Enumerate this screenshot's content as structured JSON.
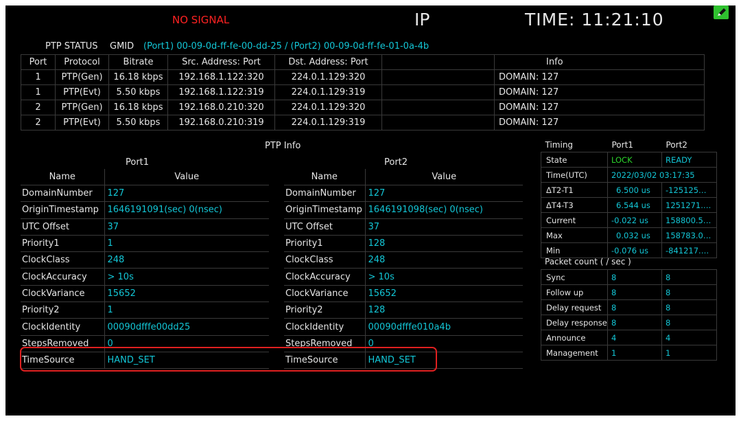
{
  "header": {
    "signal_status": "NO SIGNAL",
    "mode": "IP",
    "time": "TIME: 11:21:10"
  },
  "ptp_status": {
    "title": "PTP STATUS",
    "gmid_label": "GMID",
    "gmid_value": "(Port1) 00-09-0d-ff-fe-00-dd-25 / (Port2) 00-09-0d-ff-fe-01-0a-4b",
    "columns": [
      "Port",
      "Protocol",
      "Bitrate",
      "Src. Address: Port",
      "Dst. Address: Port",
      "Info"
    ],
    "rows": [
      {
        "port": "1",
        "protocol": "PTP(Gen)",
        "bitrate": "16.18 kbps",
        "src": "192.168.1.122:320",
        "dst": "224.0.1.129:320",
        "info": "DOMAIN: 127"
      },
      {
        "port": "1",
        "protocol": "PTP(Evt)",
        "bitrate": "5.50 kbps",
        "src": "192.168.1.122:319",
        "dst": "224.0.1.129:319",
        "info": "DOMAIN: 127"
      },
      {
        "port": "2",
        "protocol": "PTP(Gen)",
        "bitrate": "16.18 kbps",
        "src": "192.168.0.210:320",
        "dst": "224.0.1.129:320",
        "info": "DOMAIN: 127"
      },
      {
        "port": "2",
        "protocol": "PTP(Evt)",
        "bitrate": "5.50 kbps",
        "src": "192.168.0.210:319",
        "dst": "224.0.1.129:319",
        "info": "DOMAIN: 127"
      }
    ]
  },
  "ptp_info": {
    "title": "PTP Info",
    "name_header": "Name",
    "value_header": "Value",
    "port1": {
      "label": "Port1",
      "rows": [
        {
          "name": "DomainNumber",
          "value": "127"
        },
        {
          "name": "OriginTimestamp",
          "value": "1646191091(sec) 0(nsec)"
        },
        {
          "name": "UTC Offset",
          "value": "37"
        },
        {
          "name": "Priority1",
          "value": "1"
        },
        {
          "name": "ClockClass",
          "value": "248"
        },
        {
          "name": "ClockAccuracy",
          "value": "> 10s"
        },
        {
          "name": "ClockVariance",
          "value": "15652"
        },
        {
          "name": "Priority2",
          "value": "1"
        },
        {
          "name": "ClockIdentity",
          "value": "00090dfffe00dd25"
        },
        {
          "name": "StepsRemoved",
          "value": "0"
        },
        {
          "name": "TimeSource",
          "value": "HAND_SET"
        }
      ]
    },
    "port2": {
      "label": "Port2",
      "rows": [
        {
          "name": "DomainNumber",
          "value": "127"
        },
        {
          "name": "OriginTimestamp",
          "value": "1646191098(sec) 0(nsec)"
        },
        {
          "name": "UTC Offset",
          "value": "37"
        },
        {
          "name": "Priority1",
          "value": "128"
        },
        {
          "name": "ClockClass",
          "value": "248"
        },
        {
          "name": "ClockAccuracy",
          "value": "> 10s"
        },
        {
          "name": "ClockVariance",
          "value": "15652"
        },
        {
          "name": "Priority2",
          "value": "128"
        },
        {
          "name": "ClockIdentity",
          "value": "00090dfffe010a4b"
        },
        {
          "name": "StepsRemoved",
          "value": "0"
        },
        {
          "name": "TimeSource",
          "value": "HAND_SET"
        }
      ]
    }
  },
  "timing": {
    "title": "Timing",
    "port1_label": "Port1",
    "port2_label": "Port2",
    "rows": [
      {
        "name": "State",
        "port1": "LOCK",
        "port2": "READY"
      },
      {
        "name": "Time(UTC)",
        "combined": "2022/03/02 03:17:35"
      },
      {
        "name": "ΔT2-T1",
        "port1": "6.500 us",
        "port2": "-125125…"
      },
      {
        "name": "ΔT4-T3",
        "port1": "6.544 us",
        "port2": "1251271.…"
      },
      {
        "name": "Current",
        "port1": "-0.022 us",
        "port2": "158800.5…"
      },
      {
        "name": "Max",
        "port1": "0.032 us",
        "port2": "158783.0…"
      },
      {
        "name": "Min",
        "port1": "-0.076 us",
        "port2": "-841217.…"
      }
    ]
  },
  "packet_count": {
    "title": "Packet count ( / sec )",
    "rows": [
      {
        "name": "Sync",
        "port1": "8",
        "port2": "8"
      },
      {
        "name": "Follow up",
        "port1": "8",
        "port2": "8"
      },
      {
        "name": "Delay request",
        "port1": "8",
        "port2": "8"
      },
      {
        "name": "Delay response",
        "port1": "8",
        "port2": "8"
      },
      {
        "name": "Announce",
        "port1": "4",
        "port2": "4"
      },
      {
        "name": "Management",
        "port1": "1",
        "port2": "1"
      }
    ]
  },
  "colors": {
    "background": "#000000",
    "text": "#e6e6e6",
    "value": "#13c6d6",
    "lock": "#2cd42c",
    "alert": "#ff2222",
    "highlight_box": "#e02020"
  },
  "corner_icon": "edit-pencil-icon"
}
